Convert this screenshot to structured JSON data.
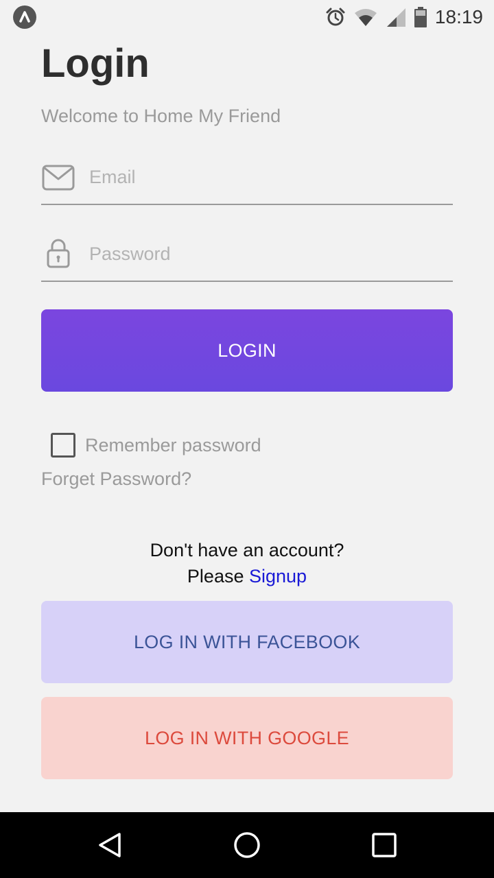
{
  "status_bar": {
    "time": "18:19",
    "icons": [
      "app-badge-icon",
      "alarm-icon",
      "wifi-icon",
      "signal-icon",
      "battery-icon"
    ]
  },
  "header": {
    "title": "Login",
    "subtitle": "Welcome to Home My Friend"
  },
  "form": {
    "email": {
      "placeholder": "Email",
      "value": "",
      "icon": "mail-icon"
    },
    "password": {
      "placeholder": "Password",
      "value": "",
      "icon": "lock-icon"
    },
    "login_label": "LOGIN",
    "remember_label": "Remember password",
    "remember_checked": false,
    "forget_label": "Forget Password?"
  },
  "signup": {
    "question": "Don't have an account?",
    "prefix": "Please ",
    "link": "Signup"
  },
  "social": {
    "facebook_label": "LOG IN WITH FACEBOOK",
    "google_label": "LOG IN WITH GOOGLE"
  },
  "colors": {
    "primary": "#7549df",
    "facebook_bg": "#d7d1f8",
    "facebook_text": "#3b5497",
    "google_bg": "#f9d3cf",
    "google_text": "#dc4a3d",
    "link": "#1a1ad6"
  },
  "nav_bar": {
    "icons": [
      "back-icon",
      "home-icon",
      "recents-icon"
    ]
  }
}
